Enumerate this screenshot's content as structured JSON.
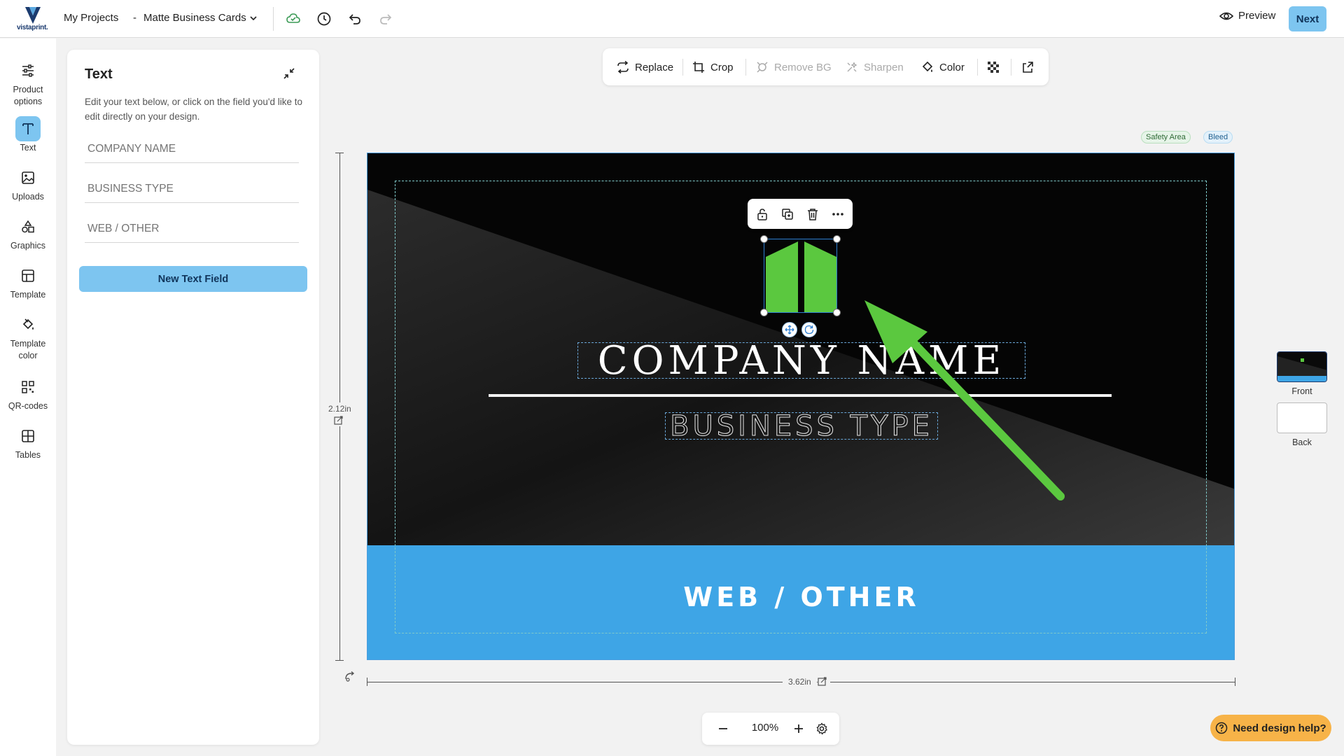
{
  "topbar": {
    "logo_text": "vistaprint.",
    "projects_label": "My Projects",
    "doc_prefix": "-",
    "doc_title": "Matte Business Cards",
    "preview_label": "Preview",
    "next_label": "Next"
  },
  "rail": {
    "items": [
      {
        "label": "Product options",
        "icon": "sliders-icon"
      },
      {
        "label": "Text",
        "icon": "text-icon"
      },
      {
        "label": "Uploads",
        "icon": "image-icon"
      },
      {
        "label": "Graphics",
        "icon": "shapes-icon"
      },
      {
        "label": "Template",
        "icon": "template-icon"
      },
      {
        "label": "Template color",
        "icon": "paint-bucket-icon"
      },
      {
        "label": "QR-codes",
        "icon": "qr-code-icon"
      },
      {
        "label": "Tables",
        "icon": "table-icon"
      }
    ],
    "active": "Text"
  },
  "panel": {
    "title": "Text",
    "description": "Edit your text below, or click on the field you'd like to edit directly on your design.",
    "fields": [
      {
        "placeholder": "COMPANY NAME",
        "value": ""
      },
      {
        "placeholder": "BUSINESS TYPE",
        "value": ""
      },
      {
        "placeholder": "WEB / OTHER",
        "value": ""
      }
    ],
    "new_field_label": "New Text Field"
  },
  "image_toolbar": {
    "replace": "Replace",
    "crop": "Crop",
    "remove_bg": "Remove BG",
    "sharpen": "Sharpen",
    "color": "Color"
  },
  "tags": {
    "safety": "Safety Area",
    "bleed": "Bleed"
  },
  "card": {
    "company_name": "COMPANY NAME",
    "business_type": "BUSINESS TYPE",
    "web_other": "WEB / OTHER",
    "logo_color": "#5bc83f",
    "band_color": "#3ea5e6",
    "background_color": "#050505"
  },
  "dimensions": {
    "height": "2.12in",
    "width": "3.62in"
  },
  "pages": {
    "front": "Front",
    "back": "Back"
  },
  "zoom": {
    "value": "100%"
  },
  "help": {
    "label": "Need design help?"
  },
  "colors": {
    "accent": "#7dc5f0",
    "help": "#f7b348",
    "arrow": "#5bc83f"
  }
}
